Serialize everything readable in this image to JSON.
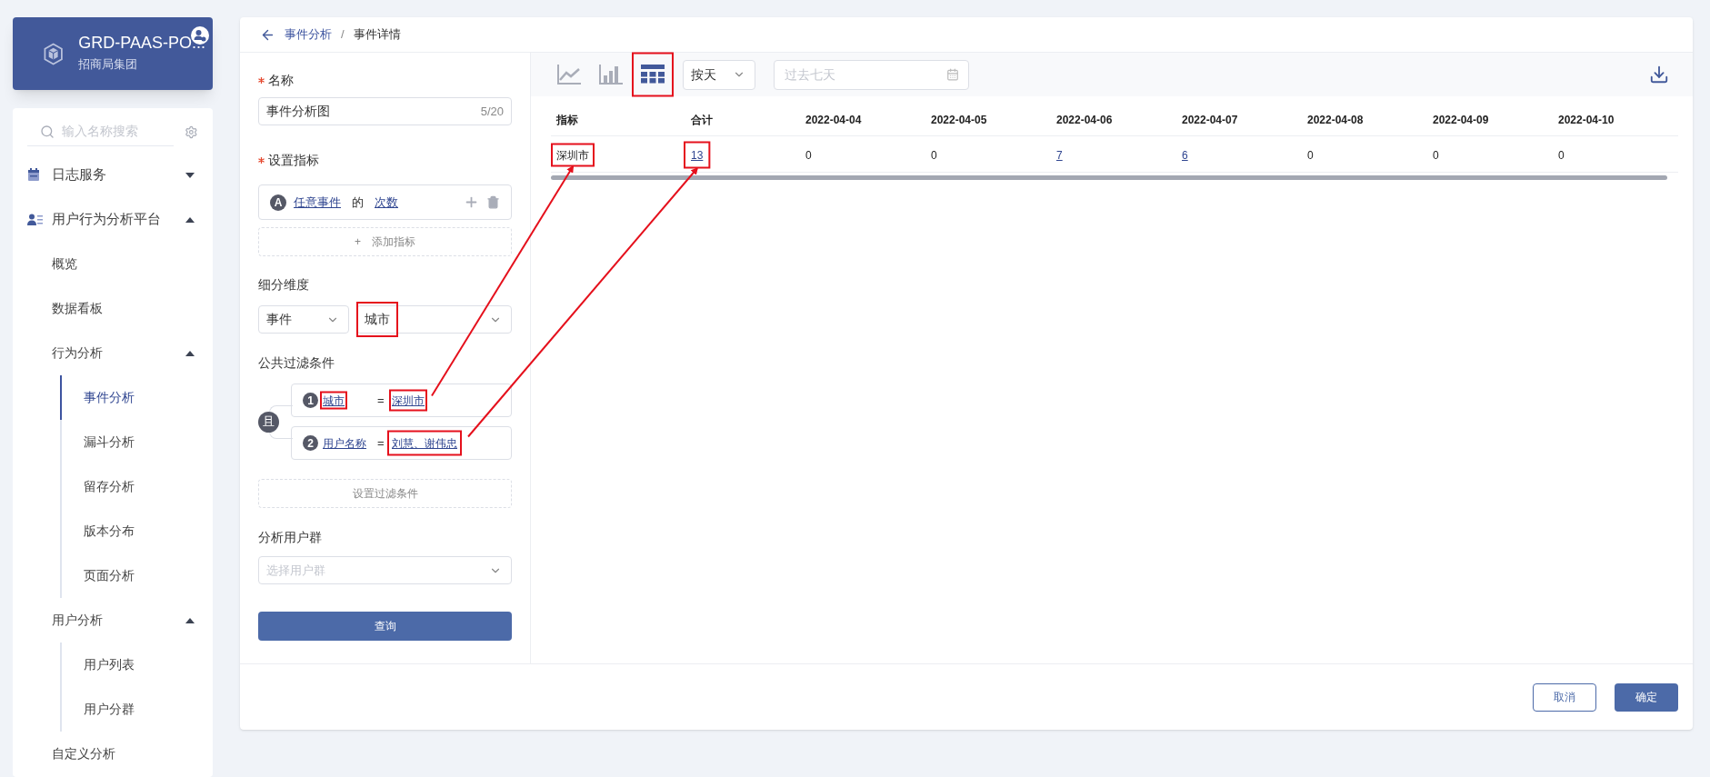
{
  "workspace": {
    "title": "GRD-PAAS-PO...",
    "subtitle": "招商局集团"
  },
  "sidebar": {
    "search_placeholder": "输入名称搜索",
    "items": [
      {
        "label": "日志服务",
        "selected": false,
        "expanded": false
      },
      {
        "label": "用户行为分析平台",
        "selected": false,
        "expanded": true,
        "children": [
          {
            "label": "概览",
            "selected": false
          },
          {
            "label": "数据看板",
            "selected": false
          },
          {
            "label": "行为分析",
            "selected": false,
            "expanded": true,
            "children": [
              {
                "label": "事件分析",
                "selected": true
              },
              {
                "label": "漏斗分析",
                "selected": false
              },
              {
                "label": "留存分析",
                "selected": false
              },
              {
                "label": "版本分布",
                "selected": false
              },
              {
                "label": "页面分析",
                "selected": false
              }
            ]
          },
          {
            "label": "用户分析",
            "selected": false,
            "expanded": true,
            "children": [
              {
                "label": "用户列表",
                "selected": false
              },
              {
                "label": "用户分群",
                "selected": false
              }
            ]
          },
          {
            "label": "自定义分析",
            "selected": false
          }
        ]
      }
    ]
  },
  "breadcrumb": {
    "items": [
      "事件分析",
      "事件详情"
    ],
    "separator": "/"
  },
  "form": {
    "name": {
      "label": "名称",
      "required": true,
      "value": "事件分析图",
      "counter": "5/20"
    },
    "metrics": {
      "label": "设置指标",
      "required": true,
      "items": [
        {
          "badge": "A",
          "event": "任意事件",
          "joiner": "的",
          "measure": "次数"
        }
      ],
      "add_button": {
        "icon": "+",
        "label": "添加指标"
      }
    },
    "breakdown": {
      "label": "细分维度",
      "selects": [
        "事件",
        "城市"
      ]
    },
    "filters": {
      "label": "公共过滤条件",
      "logic": "且",
      "items": [
        {
          "number": "1",
          "field": "城市",
          "operator": "=",
          "value": "深圳市"
        },
        {
          "number": "2",
          "field": "用户名称",
          "operator": "=",
          "value": "刘慧、谢伟忠"
        }
      ],
      "add_button": "设置过滤条件"
    },
    "user_group": {
      "label": "分析用户群",
      "placeholder": "选择用户群"
    },
    "submit": "查询"
  },
  "toolbar": {
    "view_buttons": [
      {
        "selected": false
      },
      {
        "selected": false
      },
      {
        "selected": true
      }
    ],
    "granularity": "按天",
    "date_range": {
      "placeholder": "过去七天"
    }
  },
  "table": {
    "columns": [
      "指标",
      "合计",
      "2022-04-04",
      "2022-04-05",
      "2022-04-06",
      "2022-04-07",
      "2022-04-08",
      "2022-04-09",
      "2022-04-10"
    ],
    "rows": [
      {
        "cells": [
          {
            "text": "深圳市",
            "link": false
          },
          {
            "text": "13",
            "link": true
          },
          {
            "text": "0",
            "link": false
          },
          {
            "text": "0",
            "link": false
          },
          {
            "text": "7",
            "link": true
          },
          {
            "text": "6",
            "link": true
          },
          {
            "text": "0",
            "link": false
          },
          {
            "text": "0",
            "link": false
          },
          {
            "text": "0",
            "link": false
          }
        ]
      }
    ]
  },
  "footer": {
    "buttons": [
      "取消",
      "确定"
    ]
  }
}
